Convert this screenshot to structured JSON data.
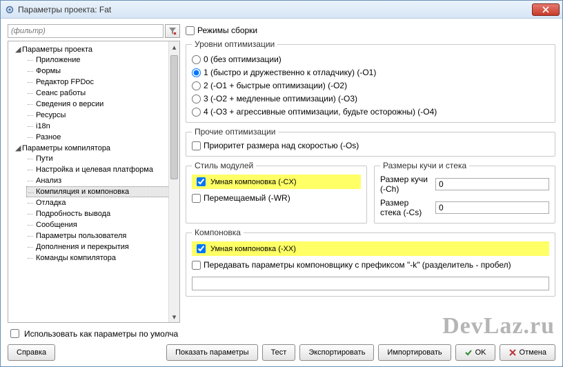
{
  "window": {
    "title": "Параметры проекта: Fat"
  },
  "filter": {
    "placeholder": "(фильтр)"
  },
  "tree": {
    "group1": {
      "label": "Параметры проекта",
      "items": [
        "Приложение",
        "Формы",
        "Редактор FPDoc",
        "Сеанс работы",
        "Сведения о версии",
        "Ресурсы",
        "i18n",
        "Разное"
      ]
    },
    "group2": {
      "label": "Параметры компилятора",
      "items": [
        "Пути",
        "Настройка и целевая платформа",
        "Анализ",
        "Компиляция и компоновка",
        "Отладка",
        "Подробность вывода",
        "Сообщения",
        "Параметры пользователя",
        "Дополнения и перекрытия",
        "Команды компилятора"
      ],
      "selected_index": 3
    }
  },
  "build_modes": {
    "label": "Режимы сборки",
    "checked": false
  },
  "opt": {
    "legend": "Уровни оптимизации",
    "o0": "0 (без оптимизации)",
    "o1": "1 (быстро и дружественно к отладчику) (-O1)",
    "o2": "2 (-O1 + быстрые оптимизации) (-O2)",
    "o3": "3 (-O2 + медленные оптимизации) (-O3)",
    "o4": "4 (-O3 + агрессивные оптимизации, будьте осторожны) (-O4)",
    "selected": 1
  },
  "other_opt": {
    "legend": "Прочие оптимизации",
    "size_priority": "Приоритет размера над скоростью (-Os)"
  },
  "unit_style": {
    "legend": "Стиль модулей",
    "smart_link": "Умная компоновка (-CX)",
    "relocatable": "Перемещаемый (-WR)"
  },
  "heap": {
    "legend": "Размеры кучи и стека",
    "heap_label": "Размер кучи (-Ch)",
    "heap_value": "0",
    "stack_label": "Размер стека (-Cs)",
    "stack_value": "0"
  },
  "linking": {
    "legend": "Компоновка",
    "smart_link": "Умная компоновка (-XX)",
    "pass_k": "Передавать параметры компоновщику с префиксом \"-k\" (разделитель - пробел)"
  },
  "use_default": "Использовать как параметры по умолча",
  "buttons": {
    "help": "Справка",
    "show_params": "Показать параметры",
    "test": "Тест",
    "export": "Экспортировать",
    "import": "Импортировать",
    "ok": "OK",
    "cancel": "Отмена"
  },
  "watermark": "DevLaz.ru"
}
